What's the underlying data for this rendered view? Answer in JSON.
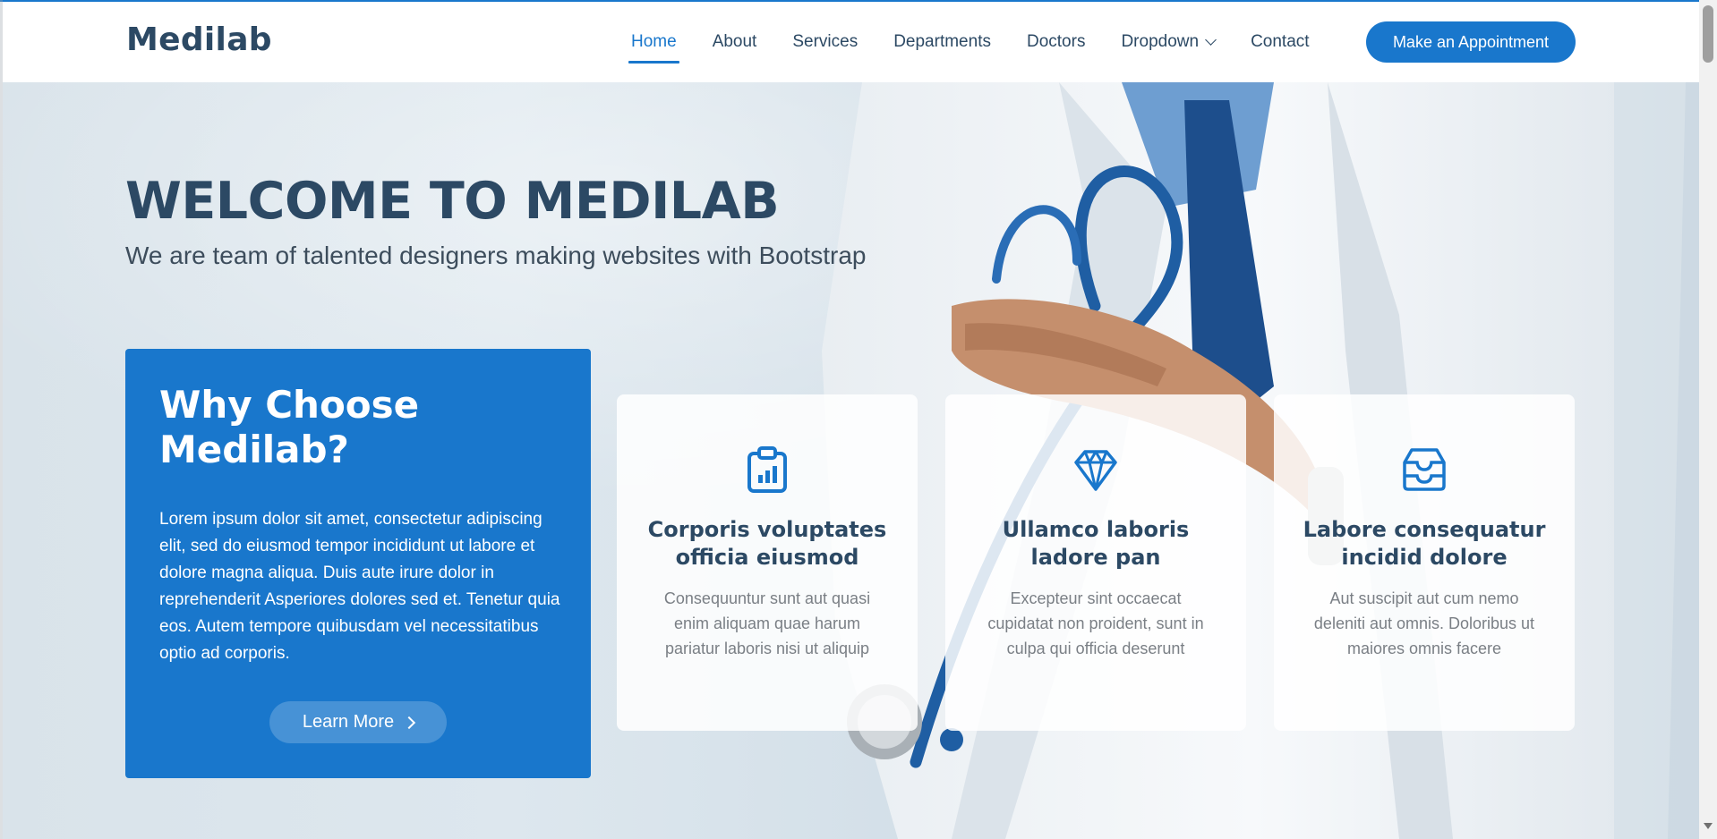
{
  "header": {
    "logo": "Medilab",
    "nav": [
      {
        "label": "Home",
        "active": true
      },
      {
        "label": "About"
      },
      {
        "label": "Services"
      },
      {
        "label": "Departments"
      },
      {
        "label": "Doctors"
      },
      {
        "label": "Dropdown",
        "icon": "chevron-down-icon"
      },
      {
        "label": "Contact"
      }
    ],
    "appointment_button": "Make an Appointment"
  },
  "hero": {
    "title": "WELCOME TO MEDILAB",
    "subtitle": "We are team of talented designers making websites with Bootstrap",
    "why": {
      "title": "Why Choose Medilab?",
      "text": "Lorem ipsum dolor sit amet, consectetur adipiscing elit, sed do eiusmod tempor incididunt ut labore et dolore magna aliqua. Duis aute irure dolor in reprehenderit Asperiores dolores sed et. Tenetur quia eos. Autem tempore quibusdam vel necessitatibus optio ad corporis.",
      "button": "Learn More"
    },
    "cards": [
      {
        "icon": "clipboard-data-icon",
        "title": "Corporis voluptates officia eiusmod",
        "text": "Consequuntur sunt aut quasi enim aliquam quae harum pariatur laboris nisi ut aliquip"
      },
      {
        "icon": "gem-icon",
        "title": "Ullamco laboris ladore pan",
        "text": "Excepteur sint occaecat cupidatat non proident, sunt in culpa qui officia deserunt"
      },
      {
        "icon": "inbox-icon",
        "title": "Labore consequatur incidid dolore",
        "text": "Aut suscipit aut cum nemo deleniti aut omnis. Doloribus ut maiores omnis facere"
      }
    ]
  },
  "colors": {
    "accent": "#1977cc",
    "heading": "#2c4964"
  }
}
